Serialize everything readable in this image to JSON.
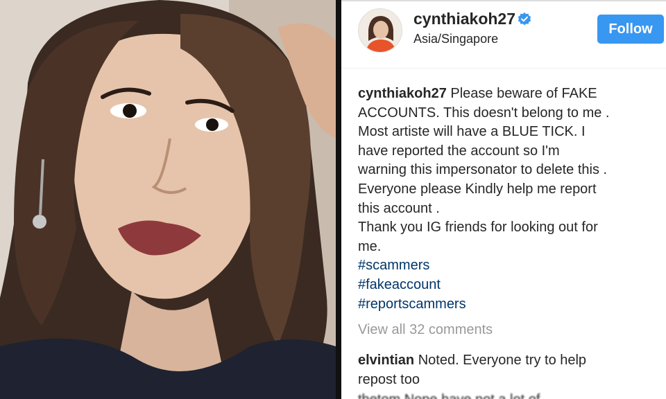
{
  "post": {
    "username": "cynthiakoh27",
    "location": "Asia/Singapore",
    "follow_label": "Follow",
    "caption_lines": [
      "Please beware of FAKE",
      "ACCOUNTS. This doesn't belong to me .",
      "Most artiste will have a BLUE TICK. I",
      "have reported the account so I'm",
      "warning this impersonator to delete this .",
      "Everyone please Kindly help me report",
      "this account .",
      "Thank you IG friends for looking out for",
      "me."
    ],
    "hashtags": [
      "#scammers",
      "#fakeaccount",
      "#reportscammers"
    ],
    "view_all": "View all 32 comments",
    "comment": {
      "user": "elvintian",
      "text_line1": "Noted. Everyone try to help",
      "text_line2": "repost too"
    },
    "partial_comment": "thetom   Nope  have not a lot of"
  },
  "colors": {
    "follow_bg": "#3897f0",
    "hashtag": "#003569",
    "muted": "#999999",
    "verified": "#3897f0"
  },
  "icons": {
    "verified": "verified-badge-icon"
  }
}
